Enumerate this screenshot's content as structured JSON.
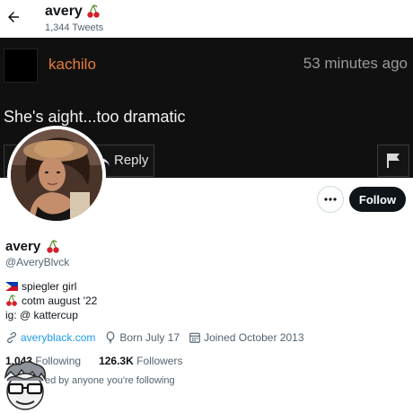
{
  "header": {
    "name": "avery",
    "tweet_count": "1,344 Tweets"
  },
  "banner": {
    "username": "kachilo",
    "time": "53 minutes ago",
    "text": "She's aight...too dramatic",
    "reply_label": "Reply"
  },
  "profile": {
    "follow_label": "Follow",
    "name": "avery",
    "handle": "@AveryBlvck",
    "bio": {
      "line1": "spiegler girl",
      "line2": "cotm august '22",
      "line3": "ig: @ kattercup"
    },
    "website": "averyblack.com",
    "birthday": "Born July 17",
    "joined": "Joined October 2013",
    "following_count": "1,043",
    "following_label": "Following",
    "followers_count": "126.3K",
    "followers_label": "Followers",
    "followed_by": "ed by anyone you're following"
  },
  "icons": [
    "back-arrow-icon",
    "cherry-emoji-icon",
    "reply-arrow-icon",
    "flag-icon",
    "more-dots-icon",
    "link-icon",
    "balloon-icon",
    "calendar-icon",
    "philippines-flag-icon"
  ],
  "colors": {
    "accent": "#1d9bf0",
    "banner_username": "#e77e35",
    "follow_button": "#0f1419"
  }
}
